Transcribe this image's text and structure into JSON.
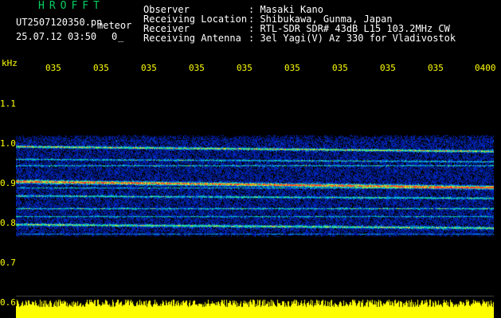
{
  "header": {
    "logo": "HROFFT",
    "filename": "UT2507120350.pn",
    "meteor_label": "meteor",
    "datetime": "25.07.12 03:50",
    "count": "0",
    "count_mark": "_"
  },
  "info": {
    "observer_label": "Observer",
    "observer_value": ": Masaki Kano",
    "location_label": "Receiving Location",
    "location_value": ": Shibukawa, Gunma, Japan",
    "receiver_label": "Receiver",
    "receiver_value": ": RTL-SDR SDR# 43dB L15 103.2MHz CW",
    "antenna_label": "Receiving Antenna",
    "antenna_value": ": 3el Yagi(V) Az 330 for Vladivostok"
  },
  "axis": {
    "y_unit": "kHz",
    "y_ticks": [
      "1.1",
      "1.0",
      "0.9",
      "0.8",
      "0.7",
      "0.6"
    ],
    "x_ticks": [
      "035",
      "035",
      "035",
      "035",
      "035",
      "035",
      "035",
      "035",
      "035",
      "0400"
    ]
  },
  "colors": {
    "background": "#000000",
    "accent_green": "#00d060",
    "label_yellow": "#ffff00",
    "noise_blue": "#1030c0",
    "signal_red": "#ff2020"
  }
}
